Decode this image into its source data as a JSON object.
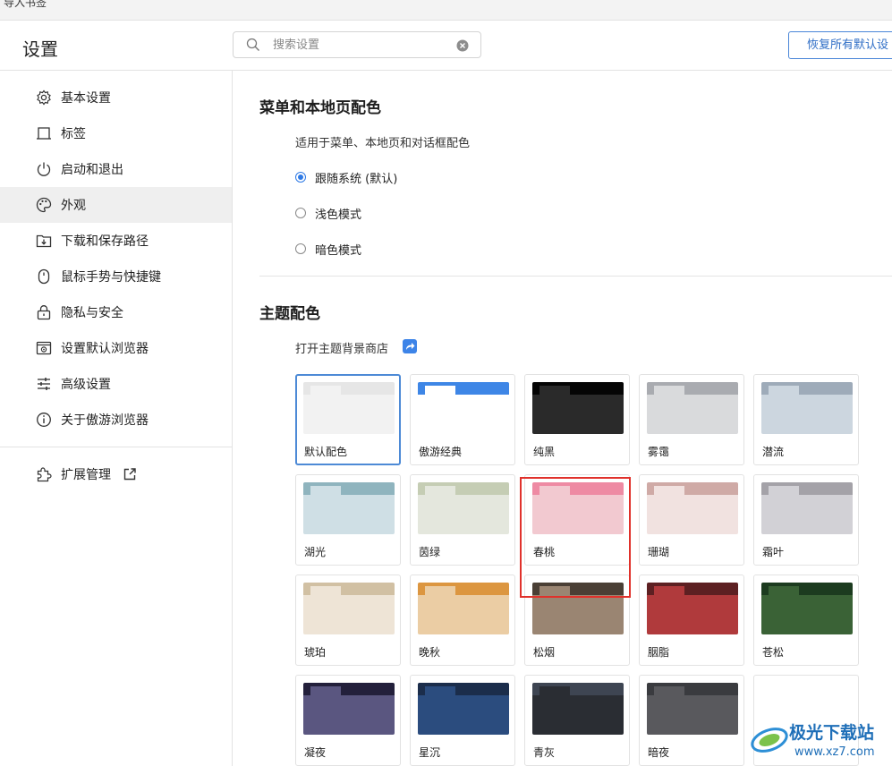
{
  "top_bar": {
    "bookmark_import": "导入书签"
  },
  "header": {
    "title": "设置",
    "search_placeholder": "搜索设置",
    "restore_button": "恢复所有默认设"
  },
  "sidebar": {
    "items": [
      {
        "label": "基本设置",
        "icon": "gear-icon"
      },
      {
        "label": "标签",
        "icon": "tab-icon"
      },
      {
        "label": "启动和退出",
        "icon": "power-icon"
      },
      {
        "label": "外观",
        "icon": "palette-icon",
        "active": true
      },
      {
        "label": "下载和保存路径",
        "icon": "download-folder-icon"
      },
      {
        "label": "鼠标手势与快捷键",
        "icon": "mouse-icon"
      },
      {
        "label": "隐私与安全",
        "icon": "lock-icon"
      },
      {
        "label": "设置默认浏览器",
        "icon": "browser-icon"
      },
      {
        "label": "高级设置",
        "icon": "sliders-icon"
      },
      {
        "label": "关于傲游浏览器",
        "icon": "info-icon"
      }
    ],
    "extensions": {
      "label": "扩展管理",
      "icon": "puzzle-icon",
      "link_icon": "external-link-icon"
    }
  },
  "menu_section": {
    "title": "菜单和本地页配色",
    "description": "适用于菜单、本地页和对话框配色",
    "options": [
      {
        "label": "跟随系统 (默认)",
        "checked": true
      },
      {
        "label": "浅色模式",
        "checked": false
      },
      {
        "label": "暗色模式",
        "checked": false
      }
    ]
  },
  "theme_section": {
    "title": "主题配色",
    "store_link": "打开主题背景商店",
    "themes": [
      {
        "name": "默认配色",
        "bar": "#e6e6e6",
        "tab": "#f2f2f2",
        "body": "#f2f2f2",
        "selected": true
      },
      {
        "name": "傲游经典",
        "bar": "#3e86e6",
        "tab": "#ffffff",
        "body": "#ffffff"
      },
      {
        "name": "纯黑",
        "bar": "#050505",
        "tab": "#2a2a2a",
        "body": "#2a2a2a"
      },
      {
        "name": "雾霭",
        "bar": "#a9abb0",
        "tab": "#d9dadc",
        "body": "#d9dadc"
      },
      {
        "name": "潜流",
        "bar": "#9eabb9",
        "tab": "#ccd6df",
        "body": "#ccd6df"
      },
      {
        "name": "湖光",
        "bar": "#8fb4be",
        "tab": "#cfdfe5",
        "body": "#cfdfe5"
      },
      {
        "name": "茵绿",
        "bar": "#c5cdb4",
        "tab": "#e4e7dd",
        "body": "#e4e7dd"
      },
      {
        "name": "春桃",
        "bar": "#ee8aa3",
        "tab": "#f2c9d0",
        "body": "#f2c9d0"
      },
      {
        "name": "珊瑚",
        "bar": "#cfaaa6",
        "tab": "#f1e2e0",
        "body": "#f1e2e0"
      },
      {
        "name": "霜叶",
        "bar": "#a4a2a8",
        "tab": "#d2d1d6",
        "body": "#d2d1d6"
      },
      {
        "name": "琥珀",
        "bar": "#d1c0a3",
        "tab": "#eee4d6",
        "body": "#eee4d6"
      },
      {
        "name": "晚秋",
        "bar": "#dc9640",
        "tab": "#ebcda4",
        "body": "#ebcda4"
      },
      {
        "name": "松烟",
        "bar": "#4a3f35",
        "tab": "#9a8572",
        "body": "#9a8572"
      },
      {
        "name": "胭脂",
        "bar": "#5d2022",
        "tab": "#b03a3c",
        "body": "#b03a3c"
      },
      {
        "name": "苍松",
        "bar": "#1c3b1f",
        "tab": "#3a6236",
        "body": "#3a6236"
      },
      {
        "name": "凝夜",
        "bar": "#23203b",
        "tab": "#5a5680",
        "body": "#5a5680"
      },
      {
        "name": "星沉",
        "bar": "#1b2d4b",
        "tab": "#2b4c7e",
        "body": "#2b4c7e"
      },
      {
        "name": "青灰",
        "bar": "#3e4552",
        "tab": "#2a2d33",
        "body": "#2a2d33"
      },
      {
        "name": "暗夜",
        "bar": "#3a3b3f",
        "tab": "#59595d",
        "body": "#59595d"
      }
    ]
  },
  "colors": {
    "accent": "#2f7ae5",
    "highlight": "#e0312b"
  }
}
